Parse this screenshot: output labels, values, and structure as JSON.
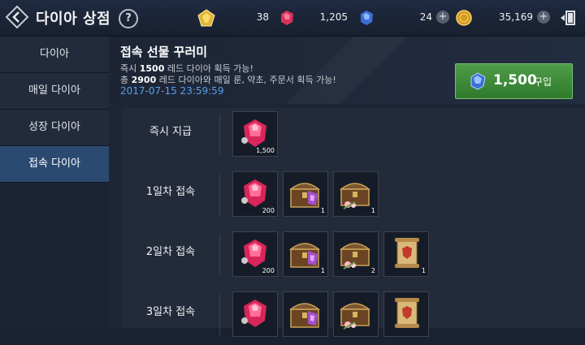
{
  "header": {
    "title": "다이아 상점",
    "help": "?"
  },
  "currencies": [
    {
      "name": "gold-gem",
      "value": "38"
    },
    {
      "name": "red-diamond",
      "value": "1,205"
    },
    {
      "name": "blue-diamond",
      "value": "24"
    },
    {
      "name": "gold-coin",
      "value": "35,169"
    }
  ],
  "sidebar": {
    "items": [
      {
        "label": "다이아",
        "active": false
      },
      {
        "label": "매일 다이아",
        "active": false
      },
      {
        "label": "성장 다이아",
        "active": false
      },
      {
        "label": "접속 다이아",
        "active": true
      }
    ]
  },
  "package": {
    "title": "접속 선물 꾸러미",
    "desc1_pre": "즉시 ",
    "desc1_bold": "1500",
    "desc1_post": " 레드 다이아 획득 가능!",
    "desc2_pre": "총 ",
    "desc2_bold": "2900",
    "desc2_post": " 레드 다이아와 매일 룬, 약초, 주문서 획득 가능!",
    "deadline": "2017-07-15 23:59:59",
    "price": "1,500",
    "buy_label": "구입"
  },
  "rewards": [
    {
      "label": "즉시 지급",
      "items": [
        {
          "icon": "red-diamond",
          "qty": "1,500"
        }
      ]
    },
    {
      "label": "1일차 접속",
      "items": [
        {
          "icon": "red-diamond",
          "qty": "200"
        },
        {
          "icon": "rune-chest",
          "qty": "1"
        },
        {
          "icon": "herb-chest",
          "qty": "1"
        }
      ]
    },
    {
      "label": "2일차 접속",
      "items": [
        {
          "icon": "red-diamond",
          "qty": "200"
        },
        {
          "icon": "rune-chest",
          "qty": "1"
        },
        {
          "icon": "herb-chest",
          "qty": "2"
        },
        {
          "icon": "scroll",
          "qty": "1"
        }
      ]
    },
    {
      "label": "3일차 접속",
      "items": [
        {
          "icon": "red-diamond",
          "qty": ""
        },
        {
          "icon": "rune-chest",
          "qty": ""
        },
        {
          "icon": "herb-chest",
          "qty": ""
        },
        {
          "icon": "scroll",
          "qty": ""
        }
      ]
    }
  ],
  "colors": {
    "accent_blue": "#5aa0e6",
    "buy_green": "#3f8c3b",
    "active_tab": "#2a4a72"
  }
}
